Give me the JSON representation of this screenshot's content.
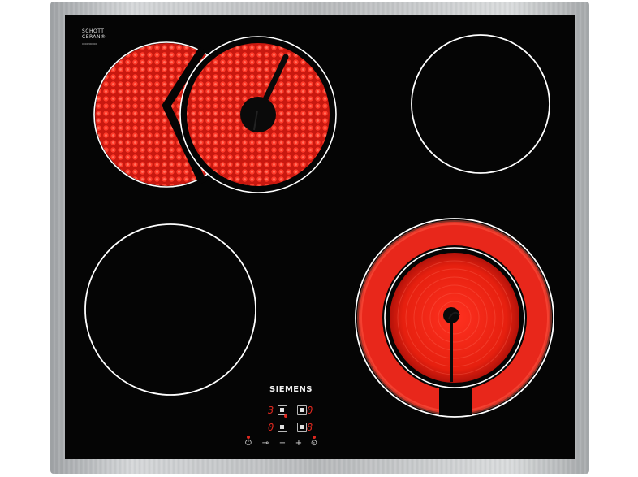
{
  "hob": {
    "logo_line1": "SCHOTT",
    "logo_line2": "CERAN®",
    "logo_code": "0000/00000",
    "brand": "SIEMENS"
  },
  "zones": [
    {
      "id": "rear-left",
      "label": "extendable dual zone",
      "heating": true
    },
    {
      "id": "rear-right",
      "label": "single zone",
      "heating": false
    },
    {
      "id": "front-left",
      "label": "single zone",
      "heating": false
    },
    {
      "id": "front-right",
      "label": "dual-circuit zone",
      "heating": true
    }
  ],
  "displays": {
    "rear_left": "3",
    "rear_right": "0",
    "front_left": "0",
    "front_right": "8"
  },
  "controls": {
    "power_symbol": "⏻",
    "lock_symbol": "⊸",
    "minus_symbol": "−",
    "plus_symbol": "+",
    "extend_symbol": "⊙"
  },
  "colors": {
    "glass": "#050505",
    "frame": "#b7b9bb",
    "heat": "#e8271b",
    "ring": "#ffffff"
  }
}
